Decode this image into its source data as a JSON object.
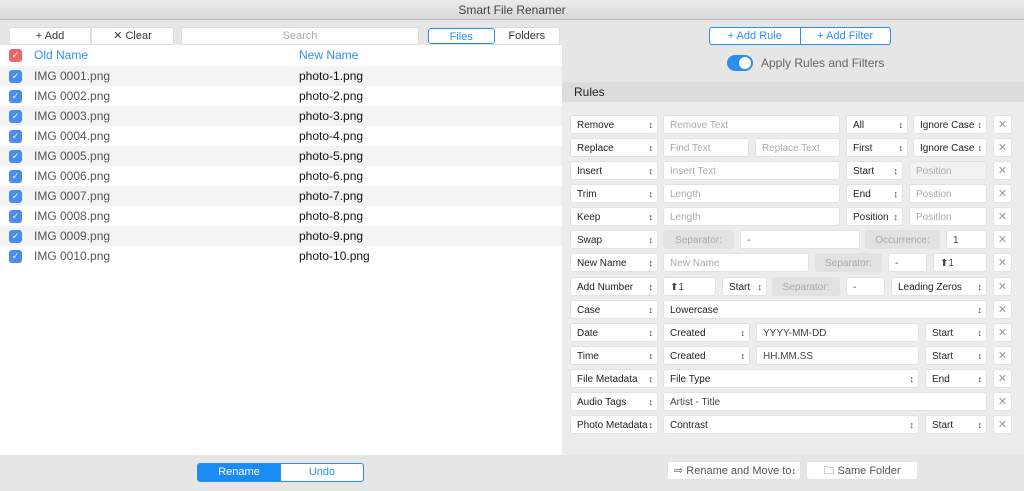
{
  "window": {
    "title": "Smart File Renamer"
  },
  "toolbar": {
    "add": "+ Add",
    "clear": "✕ Clear",
    "search_placeholder": "Search",
    "files": "Files",
    "folders": "Folders"
  },
  "list": {
    "header_old": "Old Name",
    "header_new": "New Name",
    "rows": [
      {
        "old": "IMG 0001.png",
        "new": "photo-1.png",
        "checked": true
      },
      {
        "old": "IMG 0002.png",
        "new": "photo-2.png",
        "checked": true
      },
      {
        "old": "IMG 0003.png",
        "new": "photo-3.png",
        "checked": true
      },
      {
        "old": "IMG 0004.png",
        "new": "photo-4.png",
        "checked": true
      },
      {
        "old": "IMG 0005.png",
        "new": "photo-5.png",
        "checked": true
      },
      {
        "old": "IMG 0006.png",
        "new": "photo-6.png",
        "checked": true
      },
      {
        "old": "IMG 0007.png",
        "new": "photo-7.png",
        "checked": true
      },
      {
        "old": "IMG 0008.png",
        "new": "photo-8.png",
        "checked": true
      },
      {
        "old": "IMG 0009.png",
        "new": "photo-9.png",
        "checked": true
      },
      {
        "old": "IMG 0010.png",
        "new": "photo-10.png",
        "checked": true
      }
    ]
  },
  "bottom_left": {
    "rename": "Rename",
    "undo": "Undo"
  },
  "right": {
    "add_rule": "+ Add Rule",
    "add_filter": "+ Add Filter",
    "apply_label": "Apply Rules and Filters",
    "apply_on": true,
    "rules_title": "Rules"
  },
  "rules": [
    {
      "type": "Remove",
      "controls": [
        {
          "kind": "input",
          "placeholder": "Remove Text"
        },
        {
          "kind": "select",
          "text": "All"
        },
        {
          "kind": "select",
          "text": "Ignore Case"
        }
      ]
    },
    {
      "type": "Replace",
      "controls": [
        {
          "kind": "input",
          "placeholder": "Find Text"
        },
        {
          "kind": "input",
          "placeholder": "Replace Text"
        },
        {
          "kind": "select",
          "text": "First"
        },
        {
          "kind": "select",
          "text": "Ignore Case"
        }
      ]
    },
    {
      "type": "Insert",
      "controls": [
        {
          "kind": "input",
          "placeholder": "Insert Text"
        },
        {
          "kind": "select",
          "text": "Start"
        },
        {
          "kind": "input",
          "placeholder": "Position",
          "disabled": true
        }
      ]
    },
    {
      "type": "Trim",
      "controls": [
        {
          "kind": "input",
          "placeholder": "Length"
        },
        {
          "kind": "select",
          "text": "End"
        },
        {
          "kind": "input",
          "placeholder": "Position"
        }
      ]
    },
    {
      "type": "Keep",
      "controls": [
        {
          "kind": "input",
          "placeholder": "Length"
        },
        {
          "kind": "select",
          "text": "Position"
        },
        {
          "kind": "input",
          "placeholder": "Position"
        }
      ]
    },
    {
      "type": "Swap",
      "controls": [
        {
          "kind": "label",
          "text": "Separator:"
        },
        {
          "kind": "input",
          "value": "-"
        },
        {
          "kind": "label",
          "text": "Occurrence:"
        },
        {
          "kind": "input",
          "value": "1"
        }
      ]
    },
    {
      "type": "New Name",
      "controls": [
        {
          "kind": "input",
          "placeholder": "New Name"
        },
        {
          "kind": "label",
          "text": "Separator:"
        },
        {
          "kind": "input",
          "value": "-"
        },
        {
          "kind": "input",
          "value": "⬆1"
        }
      ]
    },
    {
      "type": "Add Number",
      "controls": [
        {
          "kind": "input",
          "value": "⬆1"
        },
        {
          "kind": "select",
          "text": "Start"
        },
        {
          "kind": "label",
          "text": "Separator:"
        },
        {
          "kind": "input",
          "value": "-"
        },
        {
          "kind": "select",
          "text": "Leading Zeros"
        }
      ]
    },
    {
      "type": "Case",
      "controls": [
        {
          "kind": "select",
          "text": "Lowercase"
        }
      ]
    },
    {
      "type": "Date",
      "controls": [
        {
          "kind": "select",
          "text": "Created"
        },
        {
          "kind": "input",
          "value": "YYYY-MM-DD"
        },
        {
          "kind": "select",
          "text": "Start"
        }
      ]
    },
    {
      "type": "Time",
      "controls": [
        {
          "kind": "select",
          "text": "Created"
        },
        {
          "kind": "input",
          "value": "HH.MM.SS"
        },
        {
          "kind": "select",
          "text": "Start"
        }
      ]
    },
    {
      "type": "File Metadata",
      "controls": [
        {
          "kind": "select",
          "text": "File Type"
        },
        {
          "kind": "select",
          "text": "End"
        }
      ]
    },
    {
      "type": "Audio Tags",
      "controls": [
        {
          "kind": "input",
          "value": "Artist - Title"
        }
      ]
    },
    {
      "type": "Photo Metadata",
      "controls": [
        {
          "kind": "select",
          "text": "Contrast"
        },
        {
          "kind": "select",
          "text": "Start"
        }
      ]
    }
  ],
  "bottom_right": {
    "move_mode": "⇨ Rename and Move to",
    "folder": "Same Folder"
  },
  "colors": {
    "accent": "#2d8ef0",
    "checkbox": "#4a8cf0",
    "select_all": "#e8676b"
  }
}
